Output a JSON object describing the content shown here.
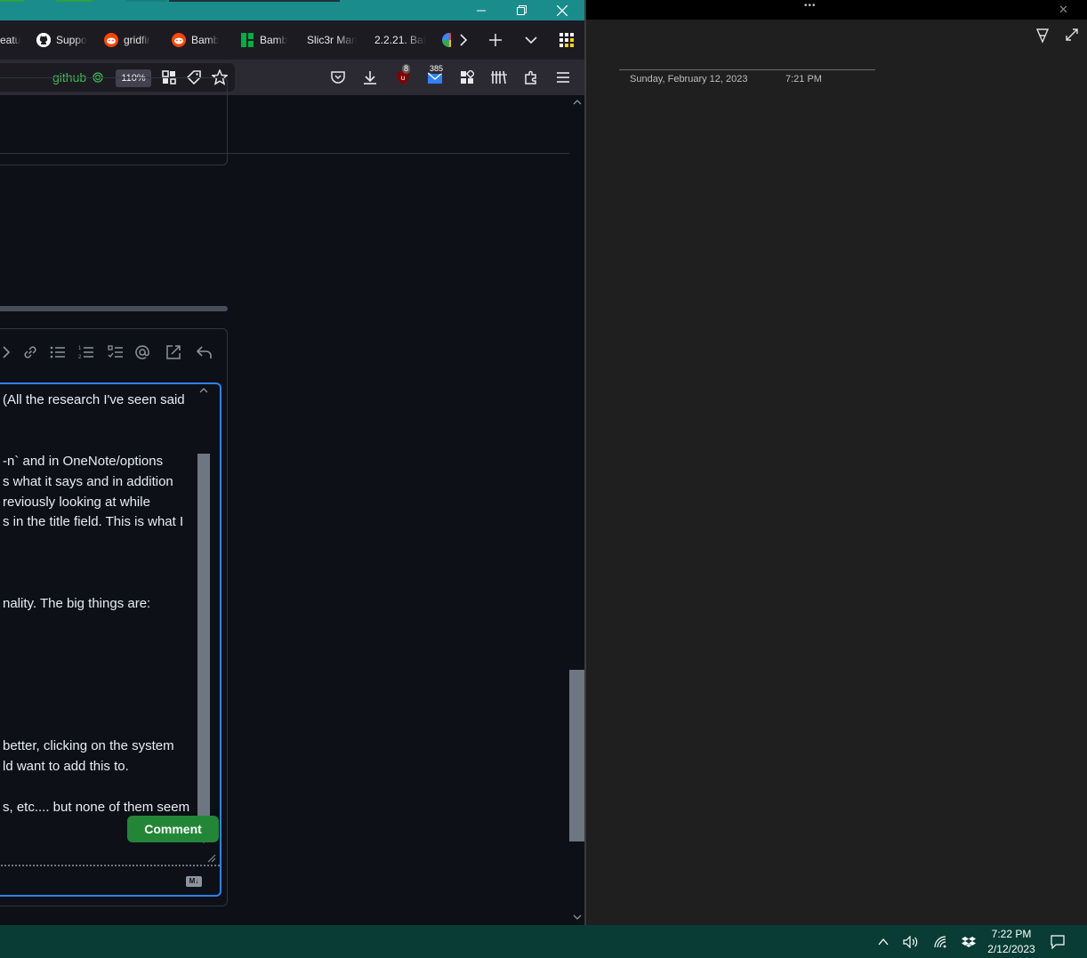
{
  "browser": {
    "window_controls": {
      "minimize": "—",
      "restore": "❐",
      "close": "✕"
    },
    "tabs": [
      {
        "label": "eatu",
        "icon": "generic-tab-icon"
      },
      {
        "label": "Suppo",
        "icon": "github-icon"
      },
      {
        "label": "gridfir",
        "icon": "reddit-icon"
      },
      {
        "label": "Bamb",
        "icon": "reddit-icon"
      },
      {
        "label": "Bamb",
        "icon": "bambu-icon"
      },
      {
        "label": "Slic3r Man",
        "icon": ""
      },
      {
        "label": "2.2.21. Bat",
        "icon": ""
      }
    ],
    "tabbar_buttons": {
      "scroll_right": "›",
      "new_tab": "+",
      "list_all_tabs": "⌄"
    },
    "urlbar": {
      "domain": "github",
      "zoom": "110%"
    },
    "toolbar_badges": {
      "ublock": "8",
      "mail": "385"
    }
  },
  "editor": {
    "lines": [
      "(All the research I've seen said",
      "",
      "",
      "-n` and in OneNote/options",
      "s what it says and in addition",
      "reviously looking at while",
      "s in the title field. This is what I",
      "",
      "",
      "",
      "nality. The big things are:",
      "",
      "",
      "",
      "",
      "",
      "",
      "better, clicking on the system",
      "ld want to add this to.",
      "",
      "s, etc.... but none of them seem"
    ],
    "markdown_badge": "M↓",
    "submit_label": "Comment"
  },
  "onenote": {
    "menu_dots": "•••",
    "close": "✕",
    "date": "Sunday, February 12, 2023",
    "time": "7:21 PM"
  },
  "taskbar": {
    "clock_time": "7:22 PM",
    "clock_date": "2/12/2023"
  },
  "colors": {
    "titlebar": "#1b8c8c",
    "page_bg": "#0d1117",
    "accent_blue": "#2f81f7",
    "github_green": "#3fb950",
    "taskbar": "#083c35",
    "onenote_bg": "#1f1f1f"
  }
}
